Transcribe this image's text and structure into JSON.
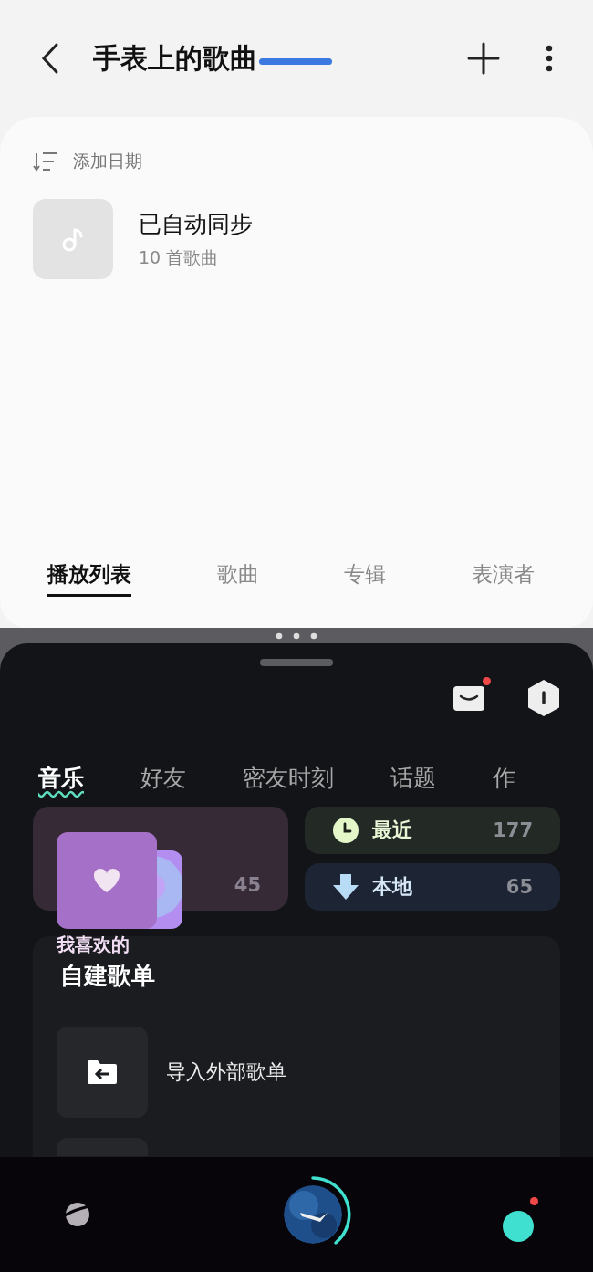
{
  "header": {
    "title": "手表上的歌曲"
  },
  "sort": {
    "label": "添加日期"
  },
  "playlists": [
    {
      "name": "已自动同步",
      "count": "10 首歌曲"
    }
  ],
  "library_tabs": [
    {
      "label": "播放列表",
      "selected": true
    },
    {
      "label": "歌曲",
      "selected": false
    },
    {
      "label": "专辑",
      "selected": false
    },
    {
      "label": "表演者",
      "selected": false
    }
  ],
  "music_app": {
    "mail_unread": true,
    "tabs": [
      {
        "label": "音乐",
        "selected": true
      },
      {
        "label": "好友",
        "selected": false
      },
      {
        "label": "密友时刻",
        "selected": false
      },
      {
        "label": "话题",
        "selected": false
      },
      {
        "label": "作",
        "selected": false
      }
    ],
    "favorites": {
      "label": "我喜欢的",
      "count": "45"
    },
    "shortcuts": [
      {
        "kind": "recent",
        "label": "最近",
        "count": "177"
      },
      {
        "kind": "local",
        "label": "本地",
        "count": "65"
      }
    ],
    "custom_playlists": {
      "title": "自建歌单",
      "items": [
        {
          "label": "导入外部歌单"
        }
      ]
    },
    "profile_unread": true
  }
}
